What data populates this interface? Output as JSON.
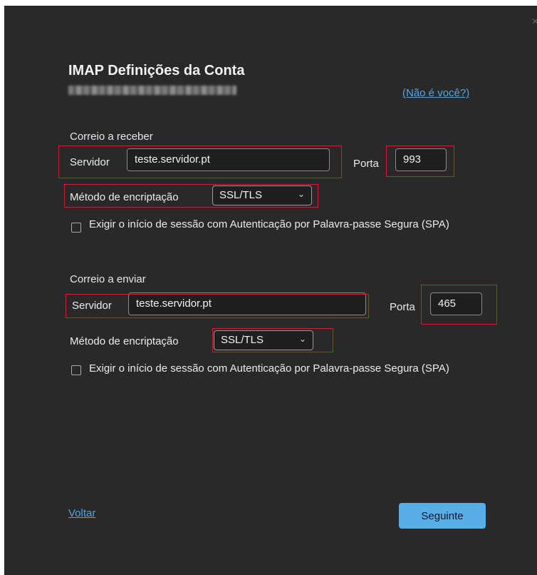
{
  "dialog": {
    "title": "IMAP Definições da Conta",
    "not_you_link": "(Não é você?)",
    "close_glyph": "×"
  },
  "incoming": {
    "section_label": "Correio a receber",
    "server_label": "Servidor",
    "server_value": "teste.servidor.pt",
    "port_label": "Porta",
    "port_value": "993",
    "encryption_label": "Método de encriptação",
    "encryption_value": "SSL/TLS",
    "spa_text": "Exigir o início de sessão com Autenticação por Palavra-passe Segura (SPA)"
  },
  "outgoing": {
    "section_label": "Correio a enviar",
    "server_label": "Servidor",
    "server_value": "teste.servidor.pt",
    "port_label": "Porta",
    "port_value": "465",
    "encryption_label": "Método de encriptação",
    "encryption_value": "SSL/TLS",
    "spa_text": "Exigir o início de sessão com Autenticação por Palavra-passe Segura (SPA)"
  },
  "footer": {
    "back_link": "Voltar",
    "next_button": "Seguinte"
  },
  "colors": {
    "background": "#292929",
    "accent": "#5aaee8",
    "link": "#4ea8e6",
    "highlight": "#d0202a"
  },
  "icons": {
    "close": "close-icon",
    "dropdown": "chevron-down-icon"
  }
}
